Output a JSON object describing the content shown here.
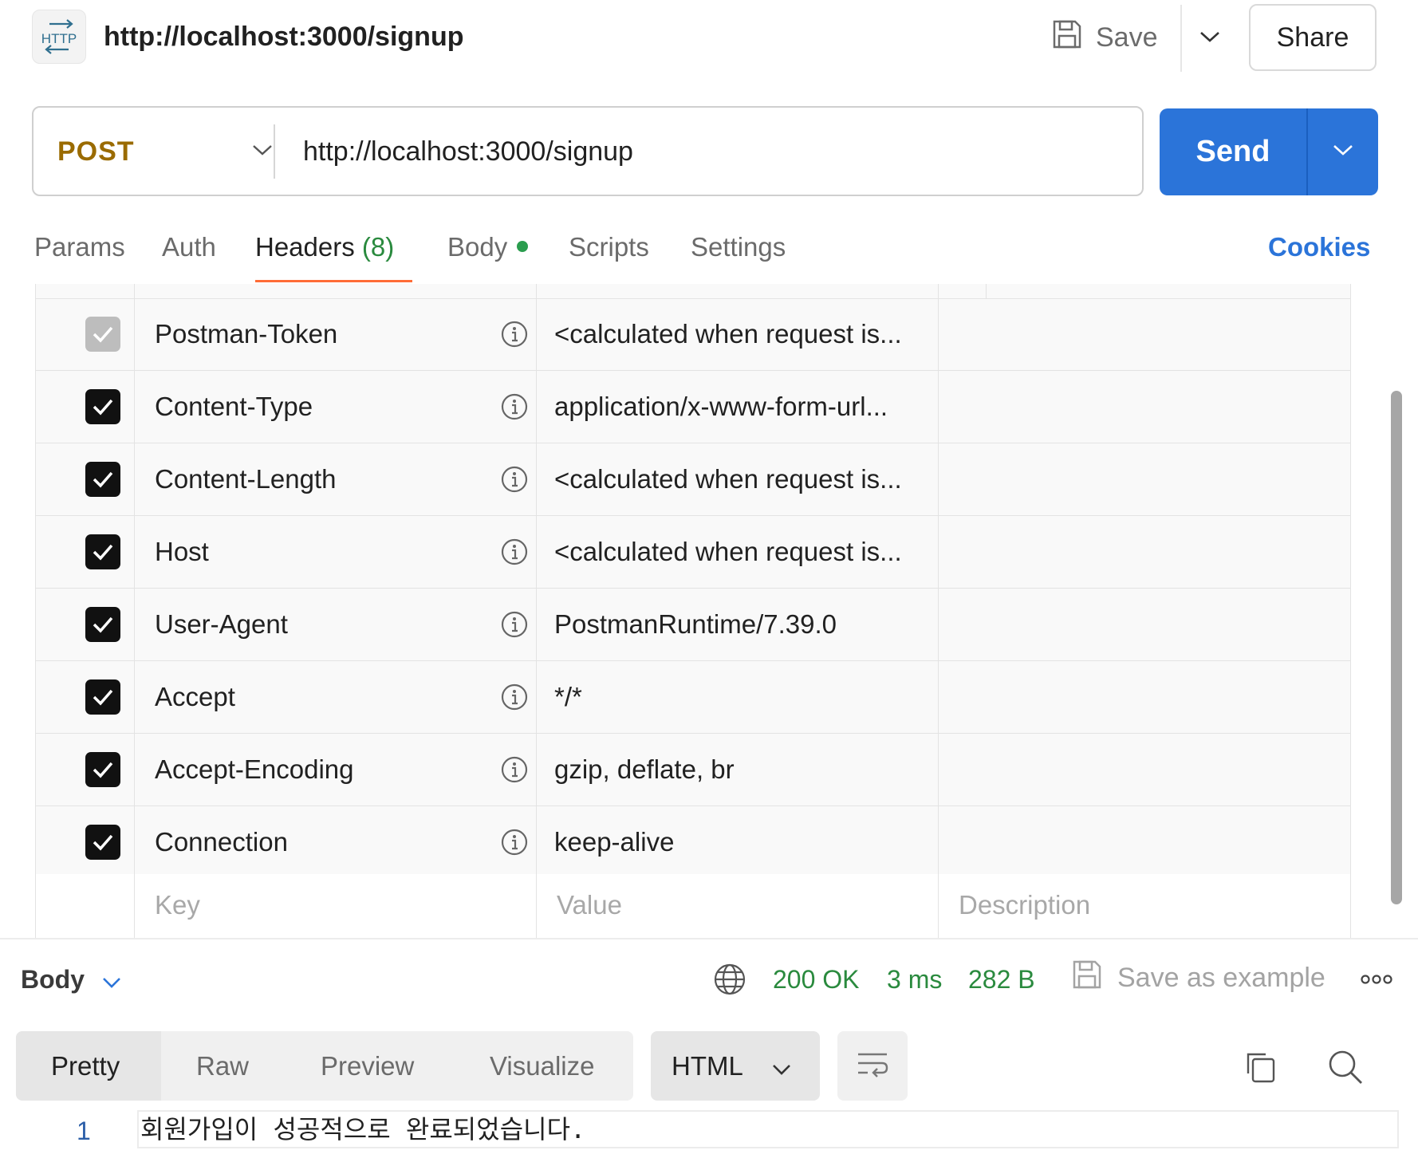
{
  "request": {
    "protocol_badge": "HTTP",
    "title": "http://localhost:3000/signup",
    "save_label": "Save",
    "share_label": "Share",
    "method": "POST",
    "url": "http://localhost:3000/signup",
    "send_label": "Send"
  },
  "tabs": {
    "params": "Params",
    "auth": "Auth",
    "headers": "Headers",
    "headers_count": "(8)",
    "body": "Body",
    "scripts": "Scripts",
    "settings": "Settings",
    "cookies": "Cookies",
    "active": "Headers"
  },
  "headers": {
    "rows": [
      {
        "key": "Postman-Token",
        "value": "<calculated when request is...",
        "checked": true,
        "disabled": true
      },
      {
        "key": "Content-Type",
        "value": "application/x-www-form-url...",
        "checked": true,
        "disabled": false
      },
      {
        "key": "Content-Length",
        "value": "<calculated when request is...",
        "checked": true,
        "disabled": false
      },
      {
        "key": "Host",
        "value": "<calculated when request is...",
        "checked": true,
        "disabled": false
      },
      {
        "key": "User-Agent",
        "value": "PostmanRuntime/7.39.0",
        "checked": true,
        "disabled": false
      },
      {
        "key": "Accept",
        "value": "*/*",
        "checked": true,
        "disabled": false
      },
      {
        "key": "Accept-Encoding",
        "value": "gzip, deflate, br",
        "checked": true,
        "disabled": false
      },
      {
        "key": "Connection",
        "value": "keep-alive",
        "checked": true,
        "disabled": false
      }
    ],
    "placeholders": {
      "key": "Key",
      "value": "Value",
      "description": "Description"
    }
  },
  "response": {
    "section_label": "Body",
    "status": "200 OK",
    "time": "3 ms",
    "size": "282 B",
    "save_example_label": "Save as example",
    "views": [
      "Pretty",
      "Raw",
      "Preview",
      "Visualize"
    ],
    "active_view": "Pretty",
    "format": "HTML",
    "lines": [
      {
        "number": "1",
        "text": "회원가입이 성공적으로 완료되었습니다."
      }
    ]
  },
  "colors": {
    "accent": "#2b74d9",
    "method": "#9a6b00",
    "success": "#2a8a3e",
    "tab_underline": "#ff6c37"
  }
}
